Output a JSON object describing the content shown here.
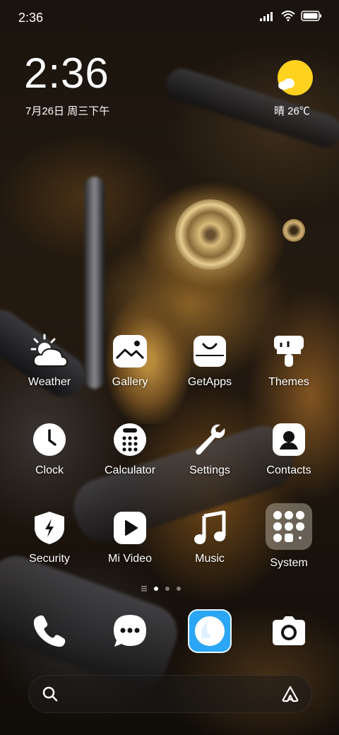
{
  "status_bar": {
    "time": "2:36",
    "icons": [
      "signal-icon",
      "wifi-icon",
      "battery-icon"
    ]
  },
  "clock_widget": {
    "time": "2:36",
    "date": "7月26日 周三下午",
    "weather": "晴 26℃",
    "weather_icon": "sunny-cloud-icon",
    "sun_color": "#FFD21F"
  },
  "apps": {
    "row1": [
      {
        "label": "Weather",
        "icon": "weather-icon"
      },
      {
        "label": "Gallery",
        "icon": "gallery-icon"
      },
      {
        "label": "GetApps",
        "icon": "getapps-icon"
      },
      {
        "label": "Themes",
        "icon": "themes-icon"
      }
    ],
    "row2": [
      {
        "label": "Clock",
        "icon": "clock-icon"
      },
      {
        "label": "Calculator",
        "icon": "calculator-icon"
      },
      {
        "label": "Settings",
        "icon": "settings-icon"
      },
      {
        "label": "Contacts",
        "icon": "contacts-icon"
      }
    ],
    "row3": [
      {
        "label": "Security",
        "icon": "security-icon"
      },
      {
        "label": "Mi Video",
        "icon": "video-icon"
      },
      {
        "label": "Music",
        "icon": "music-icon"
      },
      {
        "label": "System",
        "icon": "system-folder-icon"
      }
    ]
  },
  "page_indicator": {
    "pages": 3,
    "current": 1
  },
  "dock": [
    {
      "name": "phone",
      "icon": "phone-icon"
    },
    {
      "name": "messages",
      "icon": "messages-icon"
    },
    {
      "name": "browser",
      "icon": "browser-icon",
      "color": "#2BA6F5"
    },
    {
      "name": "camera",
      "icon": "camera-icon"
    }
  ],
  "search_bar": {
    "left_icon": "search-icon",
    "right_icon": "assistant-icon"
  }
}
